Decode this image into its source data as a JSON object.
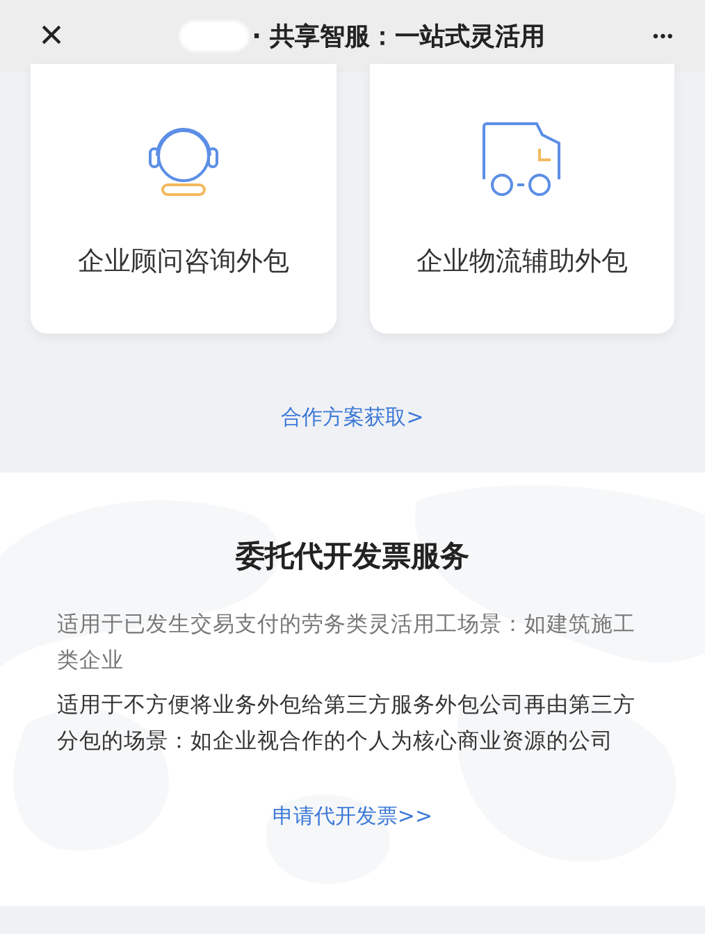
{
  "header": {
    "close": "×",
    "title": "· 共享智服：一站式灵活用",
    "more": "•••"
  },
  "cards": [
    {
      "kind": "headset",
      "label": "企业顾问咨询外包"
    },
    {
      "kind": "truck",
      "label": "企业物流辅助外包"
    }
  ],
  "cards_link": "合作方案获取>",
  "invoice": {
    "title": "委托代开发票服务",
    "paragraphs": [
      {
        "text": "适用于已发生交易支付的劳务类灵活用工场景：如建筑施工类企业",
        "dimmed": true
      },
      {
        "text": "适用于不方便将业务外包给第三方服务外包公司再由第三方分包的场景：如企业视合作的个人为核心商业资源的公司",
        "dimmed": false
      }
    ],
    "link": "申请代开发票>>"
  }
}
